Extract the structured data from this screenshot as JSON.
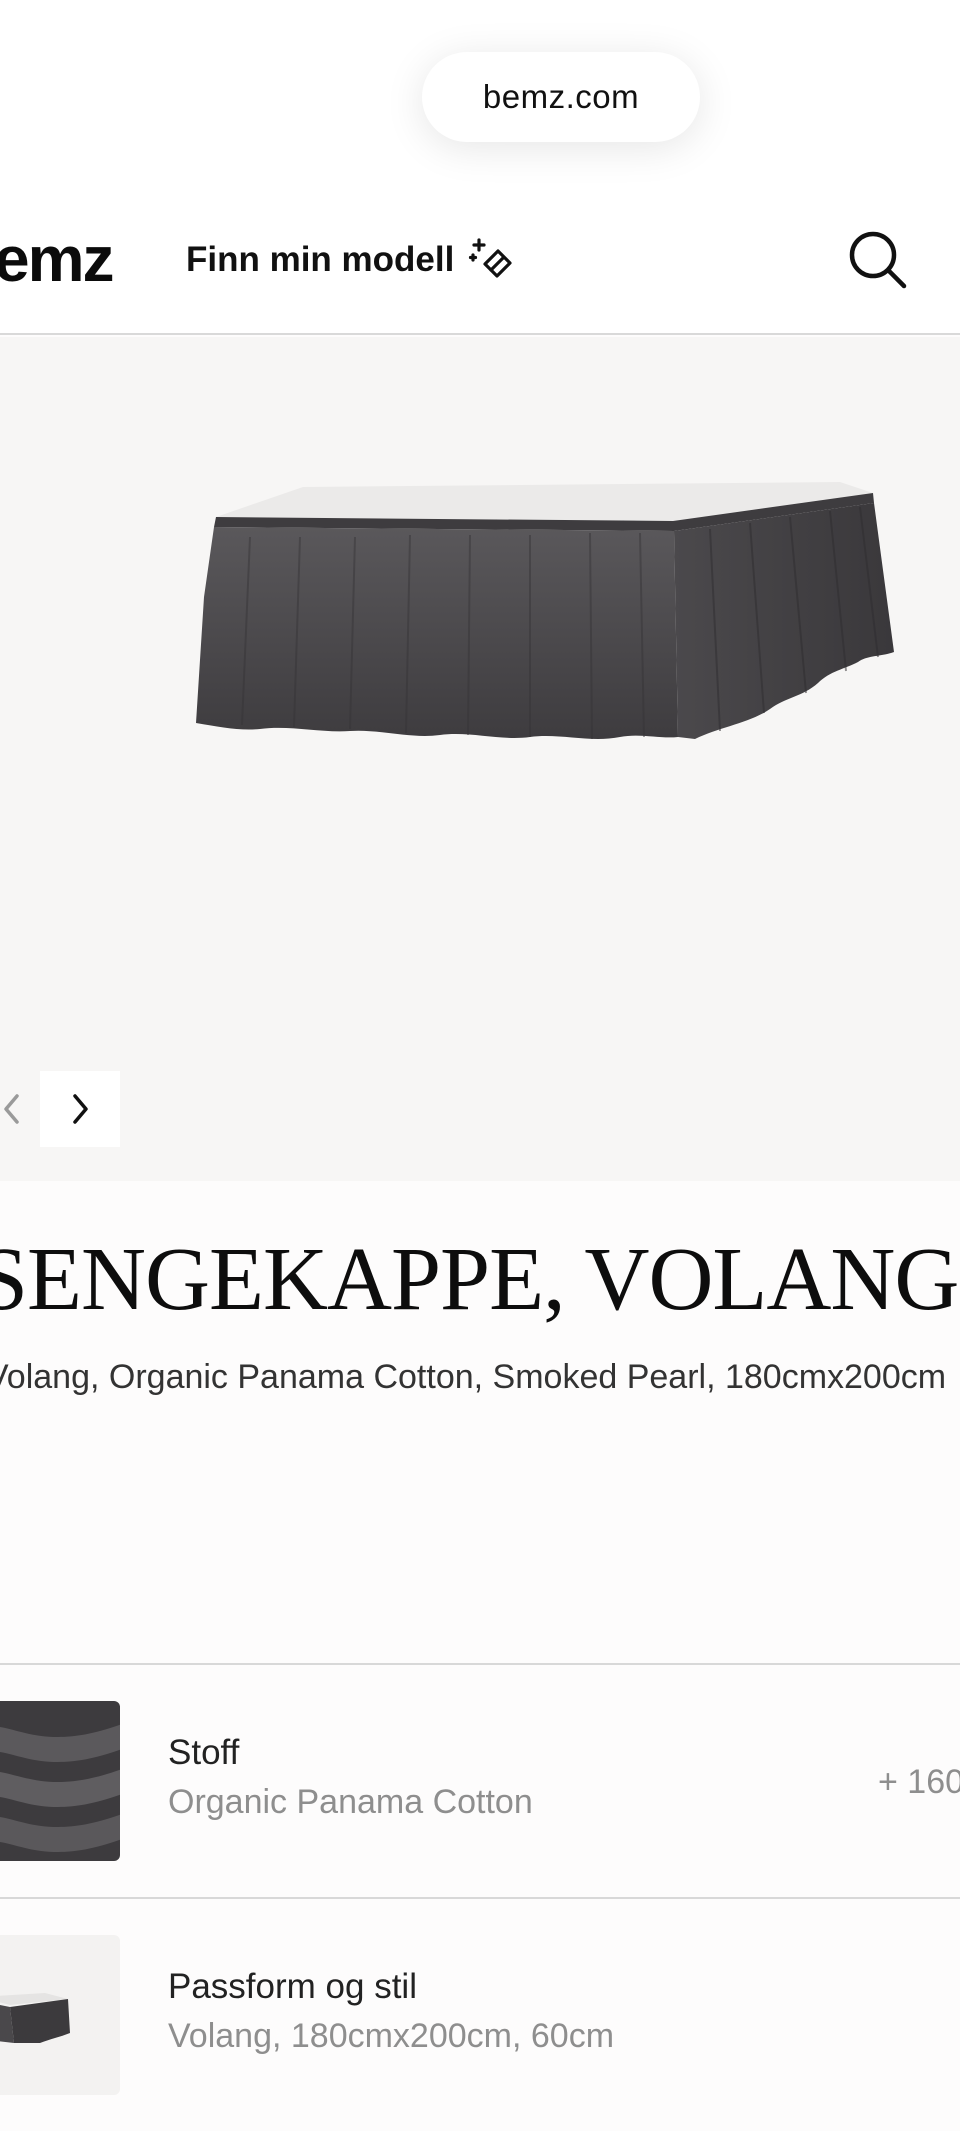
{
  "browser": {
    "url": "bemz.com"
  },
  "header": {
    "logo_text": "emz",
    "finn_label": "Finn min modell",
    "finn_icon": "sparkle-eraser-icon",
    "search_icon": "search-icon"
  },
  "gallery": {
    "image": "bed-skirt-product-image",
    "prev_icon": "chevron-left-icon",
    "next_icon": "chevron-right-icon",
    "product_color": "#4a484b"
  },
  "product": {
    "title": "SENGEKAPPE, VOLANG",
    "subtitle": "Volang, Organic Panama Cotton, Smoked Pearl, 180cmx200cm"
  },
  "options": [
    {
      "label": "Stoff",
      "value": "Organic Panama Cotton",
      "price": "+ 160"
    },
    {
      "label": "Passform og stil",
      "value": "Volang, 180cmx200cm, 60cm"
    }
  ]
}
